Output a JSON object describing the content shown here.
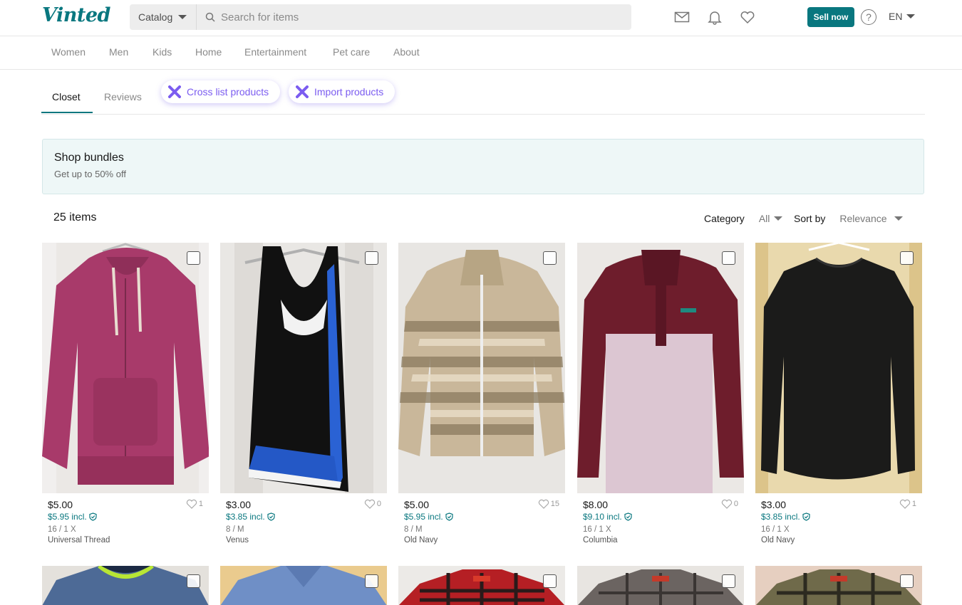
{
  "header": {
    "logo": "Vinted",
    "catalog_label": "Catalog",
    "search_placeholder": "Search for items",
    "sell_label": "Sell now",
    "help_label": "?",
    "language": "EN"
  },
  "nav": [
    "Women",
    "Men",
    "Kids",
    "Home",
    "Entertainment",
    "Pet care",
    "About"
  ],
  "tabs": {
    "closet": "Closet",
    "reviews": "Reviews",
    "cross_list": "Cross list products",
    "import": "Import products"
  },
  "banner": {
    "title": "Shop bundles",
    "subtitle": "Get up to 50% off"
  },
  "list": {
    "count": "25 items",
    "category_label": "Category",
    "category_value": "All",
    "sort_label": "Sort by",
    "sort_value": "Relevance"
  },
  "colors": {
    "brand": "#09777f",
    "accent": "#7b5cf0"
  },
  "items": [
    {
      "price": "$5.00",
      "incl": "$5.95 incl.",
      "size": "16 / 1 X",
      "brand": "Universal Thread",
      "likes": "1",
      "garment": "pink hooded zip sweatshirt"
    },
    {
      "price": "$3.00",
      "incl": "$3.85 incl.",
      "size": "8 / M",
      "brand": "Venus",
      "likes": "0",
      "garment": "black layered tank top"
    },
    {
      "price": "$5.00",
      "incl": "$5.95 incl.",
      "size": "8 / M",
      "brand": "Old Navy",
      "likes": "15",
      "garment": "tan patterned fleece jacket"
    },
    {
      "price": "$8.00",
      "incl": "$9.10 incl.",
      "size": "16 / 1 X",
      "brand": "Columbia",
      "likes": "0",
      "garment": "maroon and lavender fleece pullover"
    },
    {
      "price": "$3.00",
      "incl": "$3.85 incl.",
      "size": "16 / 1 X",
      "brand": "Old Navy",
      "likes": "1",
      "garment": "black long sleeve top"
    }
  ]
}
